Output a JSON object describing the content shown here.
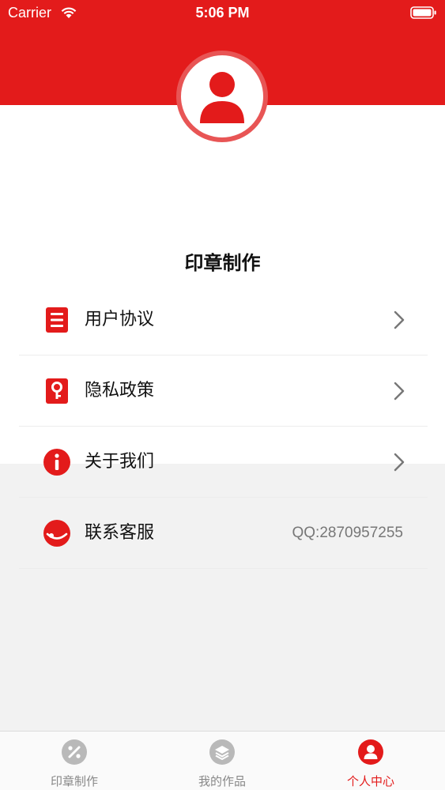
{
  "status": {
    "carrier": "Carrier",
    "time": "5:06 PM"
  },
  "profile": {
    "app_name": "印章制作"
  },
  "menu": [
    {
      "label": "用户协议",
      "icon": "document-icon",
      "trailing": "chevron"
    },
    {
      "label": "隐私政策",
      "icon": "key-lock-icon",
      "trailing": "chevron"
    },
    {
      "label": "关于我们",
      "icon": "info-icon",
      "trailing": "chevron"
    },
    {
      "label": "联系客服",
      "icon": "headset-icon",
      "trailing": "text",
      "value": "QQ:2870957255"
    }
  ],
  "tabbar": [
    {
      "label": "印章制作",
      "icon": "stamp-icon",
      "active": false
    },
    {
      "label": "我的作品",
      "icon": "layers-icon",
      "active": false
    },
    {
      "label": "个人中心",
      "icon": "user-icon",
      "active": true
    }
  ],
  "colors": {
    "accent": "#e31b1b",
    "inactive": "#888888",
    "background": "#f2f2f2"
  }
}
